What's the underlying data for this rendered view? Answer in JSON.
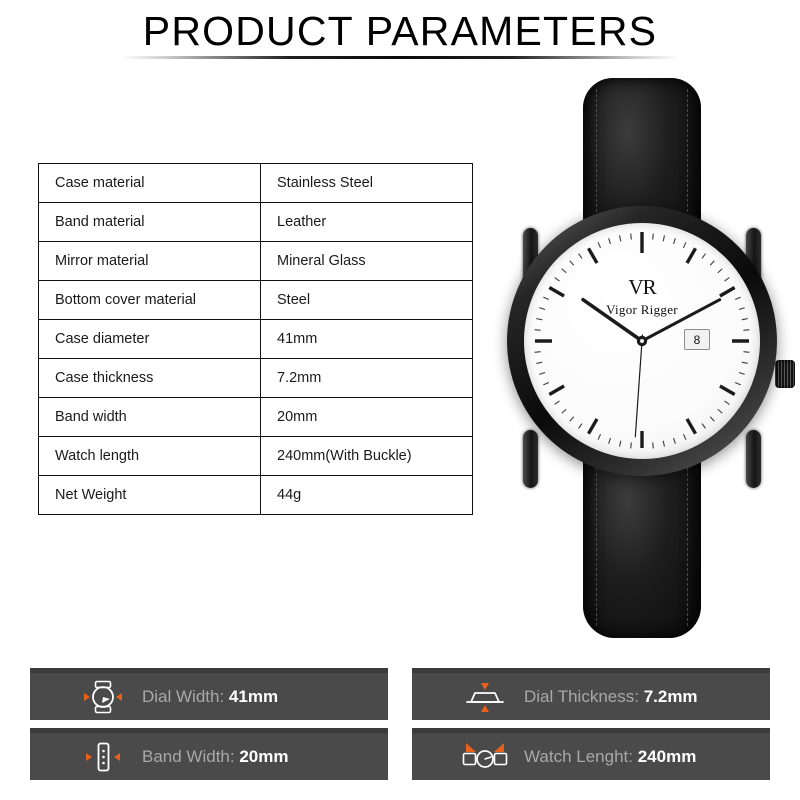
{
  "page": {
    "title": "PRODUCT PARAMETERS",
    "background_color": "#ffffff"
  },
  "spec_table": {
    "rows": [
      {
        "key": "Case material",
        "value": "Stainless Steel"
      },
      {
        "key": "Band material",
        "value": "Leather"
      },
      {
        "key": "Mirror material",
        "value": "Mineral Glass"
      },
      {
        "key": "Bottom cover material",
        "value": "Steel"
      },
      {
        "key": "Case diameter",
        "value": "41mm"
      },
      {
        "key": "Case thickness",
        "value": "7.2mm"
      },
      {
        "key": "Band width",
        "value": "20mm"
      },
      {
        "key": "Watch length",
        "value": "240mm(With Buckle)"
      },
      {
        "key": "Net Weight",
        "value": "44g"
      }
    ]
  },
  "watch": {
    "brand_monogram": "VR",
    "brand_name": "Vigor Rigger",
    "date": "8",
    "case_color": "#151515",
    "dial_color": "#ffffff",
    "strap_color": "#111111"
  },
  "info_bars": {
    "accent_color": "#e8601c",
    "bar_color": "#4a4a4a",
    "bar_top_color": "#3b3b3b",
    "label_color": "#a8a8a8",
    "value_color": "#ffffff",
    "items": [
      {
        "icon": "watch-face-icon",
        "label": "Dial Width: ",
        "value": "41mm"
      },
      {
        "icon": "case-profile-icon",
        "label": "Dial Thickness: ",
        "value": "7.2mm"
      },
      {
        "icon": "band-strip-icon",
        "label": "Band Width: ",
        "value": "20mm"
      },
      {
        "icon": "watch-full-icon",
        "label": "Watch Lenght: ",
        "value": "240mm"
      }
    ]
  }
}
